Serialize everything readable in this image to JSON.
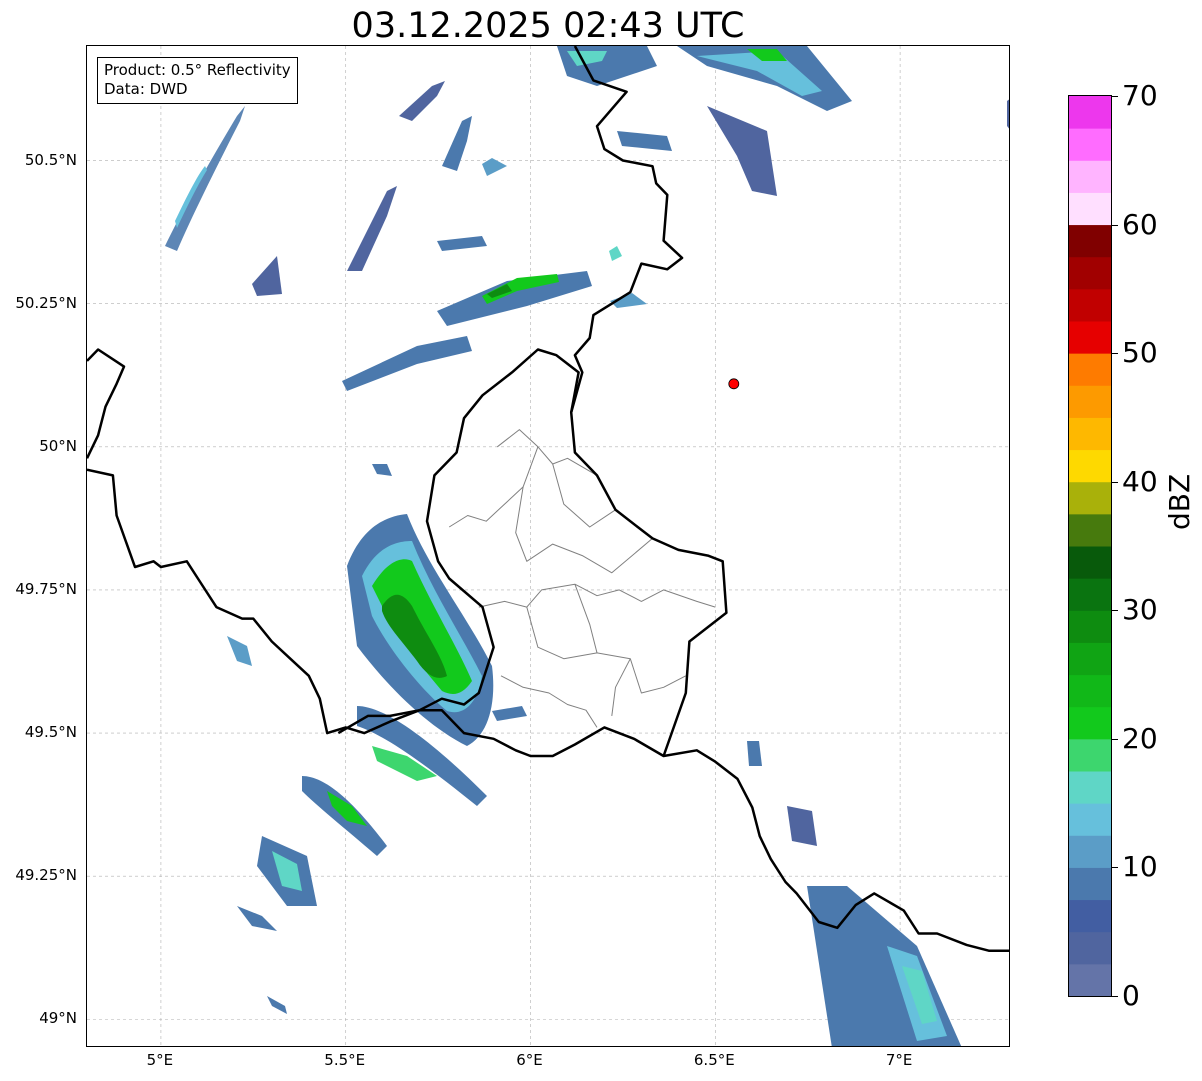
{
  "title": "03.12.2025 02:43 UTC",
  "info": {
    "product": "Product: 0.5° Reflectivity",
    "source": "Data: DWD"
  },
  "axes": {
    "lon_min": 4.8,
    "lon_max": 7.3,
    "lat_min": 48.95,
    "lat_max": 50.7,
    "lat_ticks": [
      {
        "value": 50.5,
        "label": "50.5°N"
      },
      {
        "value": 50.25,
        "label": "50.25°N"
      },
      {
        "value": 50.0,
        "label": "50°N"
      },
      {
        "value": 49.75,
        "label": "49.75°N"
      },
      {
        "value": 49.5,
        "label": "49.5°N"
      },
      {
        "value": 49.25,
        "label": "49.25°N"
      },
      {
        "value": 49.0,
        "label": "49°N"
      }
    ],
    "lon_ticks": [
      {
        "value": 5.0,
        "label": "5°E"
      },
      {
        "value": 5.5,
        "label": "5.5°E"
      },
      {
        "value": 6.0,
        "label": "6°E"
      },
      {
        "value": 6.5,
        "label": "6.5°E"
      },
      {
        "value": 7.0,
        "label": "7°E"
      }
    ],
    "grid": true
  },
  "colorbar": {
    "label": "dBZ",
    "min": 0,
    "max": 70,
    "ticks": [
      "0",
      "10",
      "20",
      "30",
      "40",
      "50",
      "60",
      "70"
    ],
    "colors": [
      "#6474a8",
      "#50659f",
      "#425ea2",
      "#4b79ad",
      "#5b9dc7",
      "#66c0dc",
      "#5fd6c6",
      "#3dd66e",
      "#12c91c",
      "#11b818",
      "#10a414",
      "#0e8c10",
      "#0a7410",
      "#085a0b",
      "#477a0d",
      "#a9b10a",
      "#fed900",
      "#feb800",
      "#fd9a00",
      "#fe7b00",
      "#e60000",
      "#c10000",
      "#a10000",
      "#800000",
      "#ffdfff",
      "#ffb4ff",
      "#ff6cff",
      "#ed37ed"
    ]
  },
  "marker": {
    "lon": 6.55,
    "lat": 50.11,
    "color": "#ff0000"
  },
  "borders": {
    "national": [
      [
        [
          4.8,
          50.15
        ],
        [
          4.83,
          50.17
        ],
        [
          4.9,
          50.14
        ],
        [
          4.88,
          50.11
        ],
        [
          4.85,
          50.07
        ],
        [
          4.83,
          50.02
        ],
        [
          4.8,
          49.98
        ]
      ],
      [
        [
          4.8,
          49.96
        ],
        [
          4.87,
          49.95
        ],
        [
          4.88,
          49.88
        ],
        [
          4.93,
          49.79
        ],
        [
          4.98,
          49.8
        ],
        [
          5.0,
          49.79
        ],
        [
          5.07,
          49.8
        ],
        [
          5.1,
          49.77
        ],
        [
          5.15,
          49.72
        ],
        [
          5.22,
          49.7
        ],
        [
          5.25,
          49.7
        ],
        [
          5.3,
          49.66
        ],
        [
          5.35,
          49.63
        ],
        [
          5.4,
          49.6
        ],
        [
          5.43,
          49.56
        ],
        [
          5.45,
          49.5
        ],
        [
          5.5,
          49.51
        ],
        [
          5.55,
          49.5
        ],
        [
          5.62,
          49.52
        ],
        [
          5.7,
          49.54
        ],
        [
          5.76,
          49.54
        ],
        [
          5.82,
          49.5
        ],
        [
          5.9,
          49.49
        ],
        [
          5.96,
          49.47
        ],
        [
          6.0,
          49.46
        ],
        [
          6.06,
          49.46
        ],
        [
          6.12,
          49.48
        ],
        [
          6.2,
          49.51
        ],
        [
          6.28,
          49.49
        ],
        [
          6.36,
          49.46
        ],
        [
          6.45,
          49.47
        ],
        [
          6.5,
          49.45
        ],
        [
          6.56,
          49.42
        ],
        [
          6.6,
          49.37
        ],
        [
          6.62,
          49.32
        ],
        [
          6.65,
          49.28
        ],
        [
          6.69,
          49.24
        ],
        [
          6.72,
          49.22
        ],
        [
          6.78,
          49.17
        ],
        [
          6.83,
          49.16
        ],
        [
          6.88,
          49.2
        ],
        [
          6.93,
          49.22
        ],
        [
          7.01,
          49.19
        ],
        [
          7.05,
          49.15
        ],
        [
          7.1,
          49.15
        ],
        [
          7.18,
          49.13
        ],
        [
          7.24,
          49.12
        ],
        [
          7.3,
          49.12
        ]
      ],
      [
        [
          6.12,
          50.7
        ],
        [
          6.17,
          50.64
        ],
        [
          6.26,
          50.62
        ],
        [
          6.18,
          50.56
        ],
        [
          6.2,
          50.52
        ],
        [
          6.25,
          50.5
        ],
        [
          6.33,
          50.49
        ],
        [
          6.34,
          50.46
        ],
        [
          6.37,
          50.44
        ],
        [
          6.36,
          50.36
        ],
        [
          6.41,
          50.33
        ],
        [
          6.37,
          50.31
        ],
        [
          6.3,
          50.32
        ],
        [
          6.27,
          50.27
        ],
        [
          6.17,
          50.23
        ],
        [
          6.16,
          50.19
        ],
        [
          6.12,
          50.16
        ],
        [
          6.14,
          50.13
        ],
        [
          6.11,
          50.06
        ],
        [
          6.12,
          49.99
        ],
        [
          6.18,
          49.95
        ],
        [
          6.23,
          49.89
        ],
        [
          6.29,
          49.86
        ],
        [
          6.33,
          49.84
        ],
        [
          6.4,
          49.82
        ],
        [
          6.48,
          49.81
        ],
        [
          6.52,
          49.8
        ],
        [
          6.53,
          49.71
        ],
        [
          6.43,
          49.66
        ],
        [
          6.42,
          49.57
        ],
        [
          6.36,
          49.46
        ]
      ],
      [
        [
          5.48,
          49.5
        ],
        [
          5.56,
          49.53
        ],
        [
          5.62,
          49.53
        ],
        [
          5.7,
          49.54
        ],
        [
          5.76,
          49.56
        ],
        [
          5.82,
          49.55
        ],
        [
          5.86,
          49.57
        ],
        [
          5.9,
          49.65
        ],
        [
          5.87,
          49.72
        ],
        [
          5.78,
          49.77
        ],
        [
          5.75,
          49.8
        ],
        [
          5.72,
          49.87
        ],
        [
          5.74,
          49.95
        ],
        [
          5.8,
          49.99
        ],
        [
          5.82,
          50.05
        ],
        [
          5.87,
          50.09
        ],
        [
          5.95,
          50.13
        ],
        [
          6.02,
          50.17
        ],
        [
          6.07,
          50.16
        ],
        [
          6.13,
          50.13
        ],
        [
          6.11,
          50.06
        ]
      ]
    ],
    "regional": [
      [
        [
          5.91,
          50.0
        ],
        [
          5.97,
          50.03
        ],
        [
          6.02,
          50.0
        ],
        [
          6.06,
          49.97
        ],
        [
          6.1,
          49.98
        ],
        [
          6.18,
          49.95
        ]
      ],
      [
        [
          6.02,
          50.0
        ],
        [
          5.98,
          49.93
        ],
        [
          5.93,
          49.9
        ],
        [
          5.88,
          49.87
        ],
        [
          5.83,
          49.88
        ],
        [
          5.78,
          49.86
        ]
      ],
      [
        [
          6.06,
          49.97
        ],
        [
          6.09,
          49.9
        ],
        [
          6.16,
          49.86
        ],
        [
          6.23,
          49.89
        ]
      ],
      [
        [
          5.98,
          49.93
        ],
        [
          5.96,
          49.85
        ],
        [
          5.99,
          49.8
        ],
        [
          6.06,
          49.83
        ],
        [
          6.14,
          49.81
        ],
        [
          6.22,
          49.78
        ],
        [
          6.33,
          49.84
        ]
      ],
      [
        [
          5.86,
          49.72
        ],
        [
          5.93,
          49.73
        ],
        [
          5.99,
          49.72
        ],
        [
          6.03,
          49.75
        ],
        [
          6.12,
          49.76
        ],
        [
          6.18,
          49.74
        ],
        [
          6.24,
          49.75
        ],
        [
          6.3,
          49.73
        ],
        [
          6.36,
          49.75
        ],
        [
          6.45,
          49.73
        ],
        [
          6.5,
          49.72
        ]
      ],
      [
        [
          5.99,
          49.72
        ],
        [
          6.02,
          49.65
        ],
        [
          6.09,
          49.63
        ],
        [
          6.18,
          49.64
        ],
        [
          6.27,
          49.63
        ],
        [
          6.3,
          49.57
        ],
        [
          6.36,
          49.58
        ],
        [
          6.42,
          49.6
        ]
      ],
      [
        [
          5.92,
          49.6
        ],
        [
          5.98,
          49.58
        ],
        [
          6.05,
          49.57
        ],
        [
          6.1,
          49.55
        ],
        [
          6.15,
          49.54
        ],
        [
          6.18,
          49.51
        ]
      ],
      [
        [
          6.27,
          49.63
        ],
        [
          6.23,
          49.58
        ],
        [
          6.22,
          49.53
        ]
      ],
      [
        [
          6.12,
          49.76
        ],
        [
          6.16,
          49.69
        ],
        [
          6.18,
          49.64
        ]
      ]
    ]
  }
}
